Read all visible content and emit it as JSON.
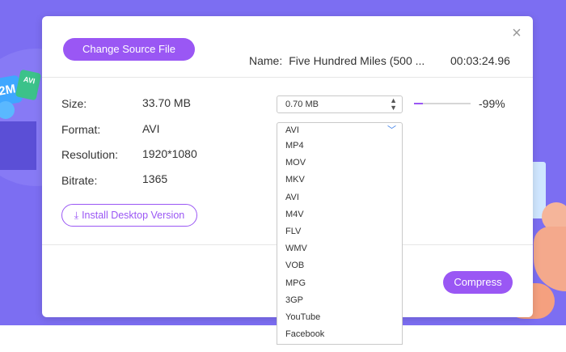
{
  "dialog": {
    "change_source_label": "Change Source File",
    "name_label": "Name:",
    "name_value": "Five Hundred Miles (500 ...",
    "duration": "00:03:24.96",
    "close_symbol": "×"
  },
  "info": {
    "size_label": "Size:",
    "size_value": "33.70 MB",
    "format_label": "Format:",
    "format_value": "AVI",
    "resolution_label": "Resolution:",
    "resolution_value": "1920*1080",
    "bitrate_label": "Bitrate:",
    "bitrate_value": "1365"
  },
  "size_control": {
    "value": "0.70  MB",
    "slider_percent": 99,
    "percent_label": "-99%"
  },
  "format_dropdown": {
    "selected": "AVI",
    "options": [
      "MP4",
      "MOV",
      "MKV",
      "AVI",
      "M4V",
      "FLV",
      "WMV",
      "VOB",
      "MPG",
      "3GP",
      "YouTube",
      "Facebook"
    ]
  },
  "install_label": "Install Desktop Version",
  "compress_label": "Compress",
  "background": {
    "tag1_text": "2M",
    "tag2_text": "AVI"
  },
  "colors": {
    "accent": "#9a57f4",
    "background_band": "#7c6ef2",
    "chevron": "#3a7ee8"
  },
  "icons": {
    "close": "close-icon",
    "download": "download-icon",
    "spinner": "stepper-icon",
    "chevron": "chevron-down-icon"
  }
}
